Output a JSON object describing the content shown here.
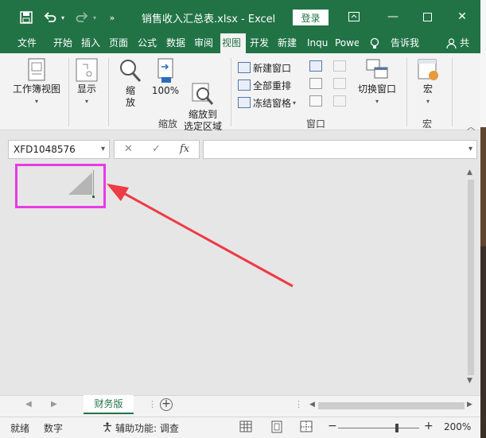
{
  "titlebar": {
    "title": "销售收入汇总表.xlsx  -  Excel",
    "login": "登录"
  },
  "tabs": [
    {
      "label": "文件"
    },
    {
      "label": "开始"
    },
    {
      "label": "插入"
    },
    {
      "label": "页面"
    },
    {
      "label": "公式"
    },
    {
      "label": "数据"
    },
    {
      "label": "审阅"
    },
    {
      "label": "视图"
    },
    {
      "label": "开发"
    },
    {
      "label": "新建"
    },
    {
      "label": "Inqu"
    },
    {
      "label": "Powe"
    },
    {
      "label": "告诉我"
    },
    {
      "label": "共"
    }
  ],
  "active_tab": "视图",
  "ribbon": {
    "workbook_view": "工作簿视图",
    "show": "显示",
    "zoom": "缩放",
    "zoom100": "100%",
    "zoom_selection": "缩放到\n选定区域",
    "zoom_group": "缩放",
    "new_window": "新建窗口",
    "arrange_all": "全部重排",
    "freeze_panes": "冻结窗格",
    "window_group": "窗口",
    "switch_windows": "切换窗口",
    "macros": "宏",
    "macros_group": "宏"
  },
  "namebox": "XFD1048576",
  "formula_bar": {
    "cancel": "✕",
    "enter": "✓",
    "fx": "fx",
    "value": ""
  },
  "sheets": [
    {
      "label": "财务版"
    }
  ],
  "statusbar": {
    "ready": "就绪",
    "numlock": "数字",
    "accessibility": "辅助功能: 调查",
    "zoom_minus": "−",
    "zoom_plus": "+",
    "zoom_level": "200%"
  },
  "colors": {
    "excel_green": "#217346",
    "highlight": "#e63be6",
    "arrow": "#ee3b45"
  }
}
